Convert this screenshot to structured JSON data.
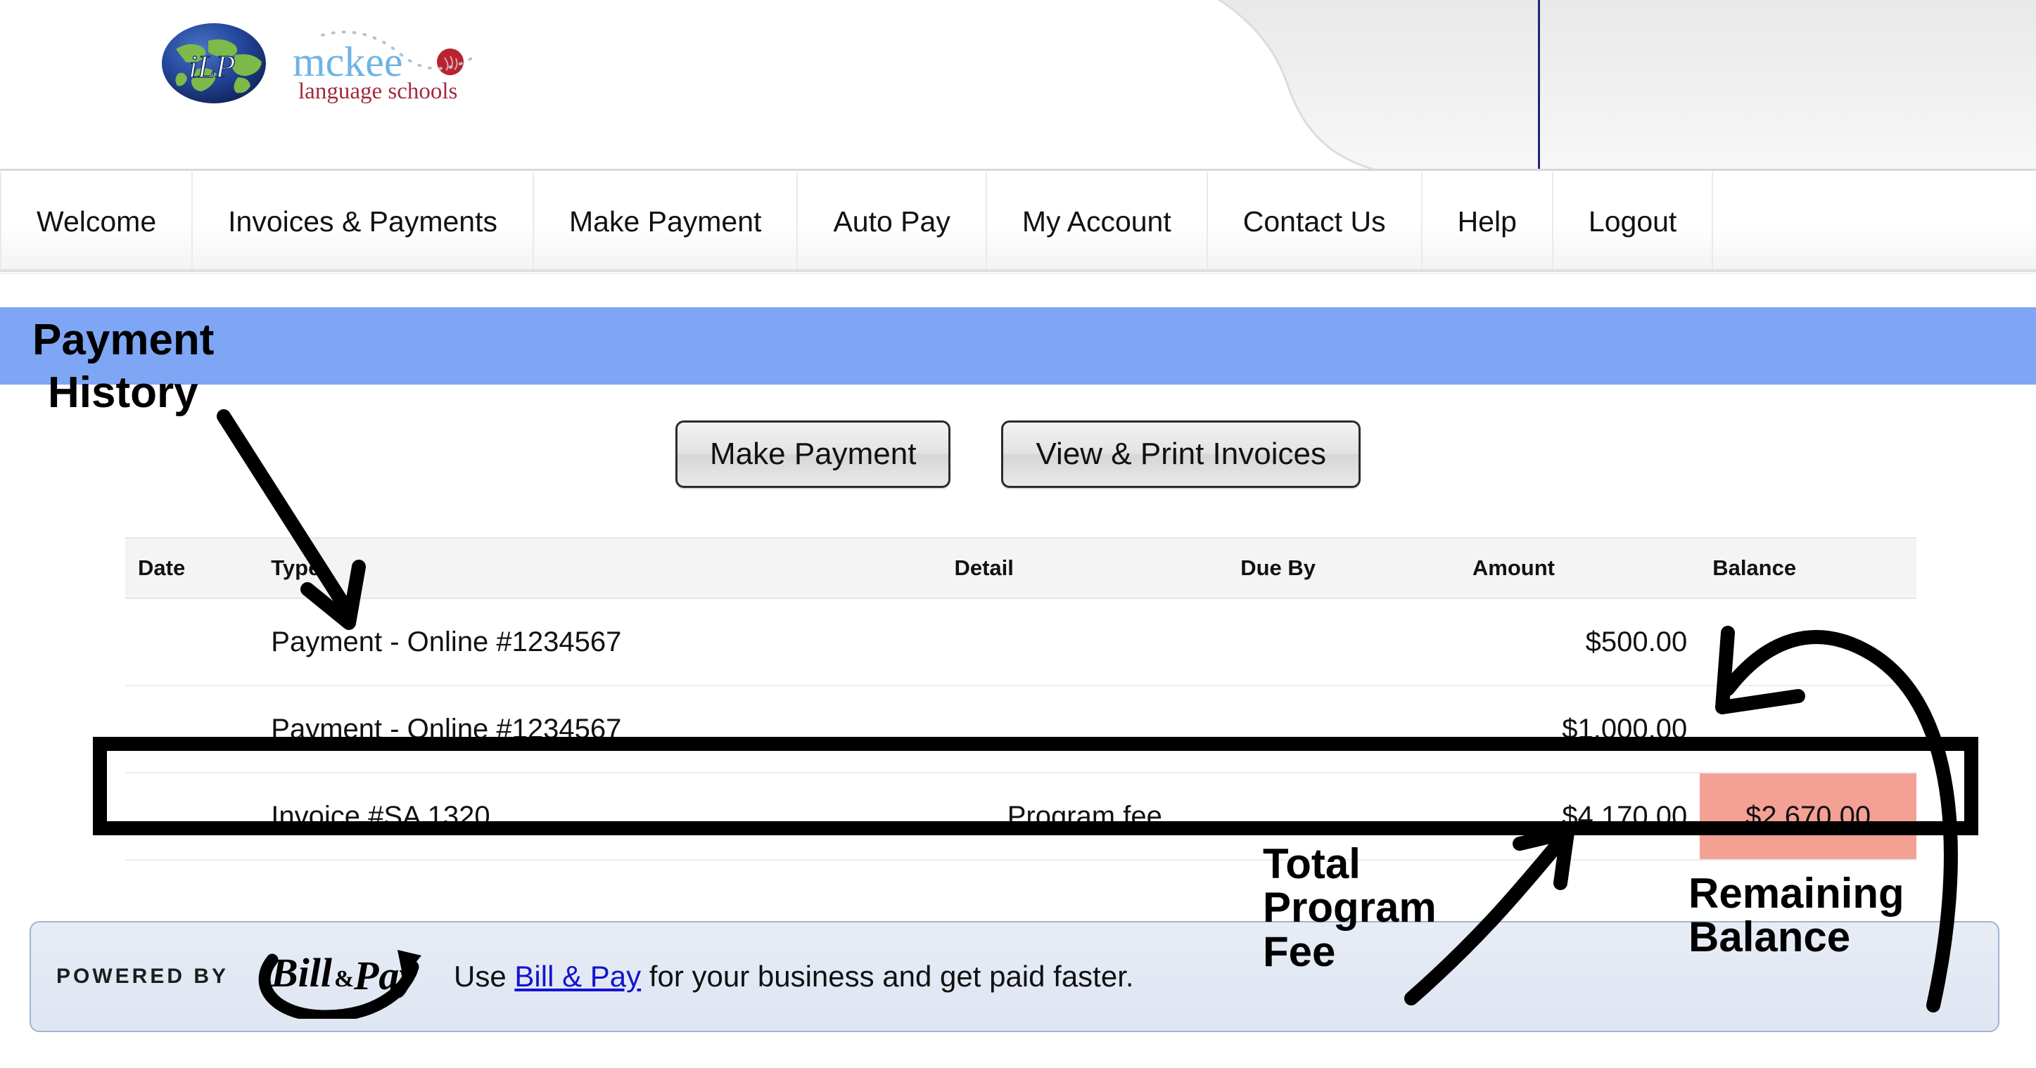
{
  "header": {
    "logo": {
      "globe_text": "iLP",
      "brand_primary": "mckee",
      "brand_secondary": "language schools",
      "brand_primary_color": "#6eb4e4",
      "brand_secondary_color": "#a42a3c",
      "globe_color": "#1d3f87",
      "globe_land_color": "#7dba4a",
      "dot_color": "#b8232f"
    },
    "divider_color": "#23257a"
  },
  "nav": {
    "items": [
      {
        "label": "Welcome"
      },
      {
        "label": "Invoices & Payments"
      },
      {
        "label": "Make Payment"
      },
      {
        "label": "Auto Pay"
      },
      {
        "label": "My Account"
      },
      {
        "label": "Contact Us"
      },
      {
        "label": "Help"
      },
      {
        "label": "Logout"
      }
    ]
  },
  "banner": {
    "color": "#7ea6f5"
  },
  "actions": {
    "make_payment_label": "Make Payment",
    "view_print_label": "View & Print Invoices"
  },
  "table": {
    "headers": [
      "Date",
      "Type",
      "Detail",
      "Due By",
      "Amount",
      "Balance"
    ],
    "rows": [
      {
        "date": "",
        "type": "Payment - Online #1234567",
        "detail": "",
        "due_by": "",
        "amount": "$500.00",
        "balance": "",
        "balance_highlight": false
      },
      {
        "date": "",
        "type": "Payment - Online #1234567",
        "detail": "",
        "due_by": "",
        "amount": "$1,000.00",
        "balance": "",
        "balance_highlight": false
      },
      {
        "date": "",
        "type": "Invoice #SA 1320",
        "detail": "Program fee",
        "due_by": "",
        "amount": "$4,170.00",
        "balance": "$2,670.00",
        "balance_highlight": true
      }
    ],
    "highlight_color": "#f4a094"
  },
  "footer": {
    "powered_by": "POWERED BY",
    "logo_text": "Bill&Pay",
    "message_prefix": "Use ",
    "link_text": "Bill & Pay",
    "message_suffix": " for your business and get paid faster.",
    "link_color": "#1414d0"
  },
  "annotations": {
    "payment_label": "Payment",
    "history_label": "History",
    "total_program_fee": "Total\nProgram\nFee",
    "remaining_balance": "Remaining\nBalance",
    "ink_color": "#000000"
  }
}
